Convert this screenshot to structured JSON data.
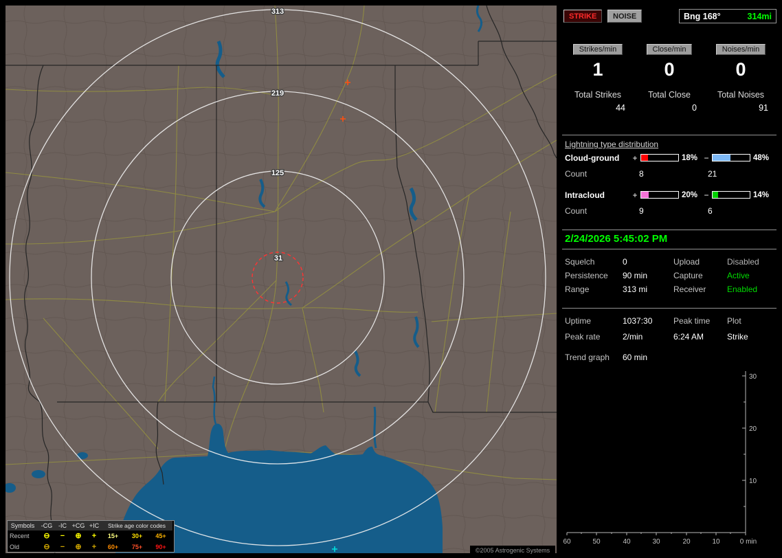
{
  "map": {
    "ring_labels": [
      "313",
      "219",
      "125",
      "31"
    ],
    "legend": {
      "header_symbols": "Symbols",
      "columns": [
        "-CG",
        "-IC",
        "+CG",
        "+IC"
      ],
      "age_title": "Strike age color codes",
      "symbols": [
        "⊖",
        "−",
        "⊕",
        "+"
      ],
      "rows": [
        {
          "label": "Recent",
          "symbol_color": "#ffff00",
          "ages": [
            {
              "text": "15+",
              "color": "#ffff80"
            },
            {
              "text": "30+",
              "color": "#ffe000"
            },
            {
              "text": "45+",
              "color": "#ffb400"
            }
          ]
        },
        {
          "label": "Old",
          "symbol_color": "#d2a800",
          "ages": [
            {
              "text": "60+",
              "color": "#ff8c00"
            },
            {
              "text": "75+",
              "color": "#ff5028"
            },
            {
              "text": "90+",
              "color": "#ff1414"
            }
          ]
        }
      ]
    },
    "copyright": "©2005 Astrogenic Systems"
  },
  "panel": {
    "strike_button": "STRIKE",
    "noise_button": "NOISE",
    "bearing": {
      "label": "Bng 168°",
      "distance": "314mi",
      "distance_color": "#00ff00"
    },
    "columns": [
      {
        "header": "Strikes/min",
        "per_min": "1",
        "total_label": "Total Strikes",
        "total": "44"
      },
      {
        "header": "Close/min",
        "per_min": "0",
        "total_label": "Total Close",
        "total": "0"
      },
      {
        "header": "Noises/min",
        "per_min": "0",
        "total_label": "Total Noises",
        "total": "91"
      }
    ],
    "distribution": {
      "title": "Lightning type distribution",
      "count_label": "Count",
      "plus_sign": "+",
      "minus_sign": "−",
      "rows": [
        {
          "label": "Cloud-ground",
          "pos": {
            "pct": 18,
            "pct_text": "18%",
            "count": "8",
            "color": "#ff0000"
          },
          "neg": {
            "pct": 48,
            "pct_text": "48%",
            "count": "21",
            "color": "#7db8f5"
          }
        },
        {
          "label": "Intracloud",
          "pos": {
            "pct": 20,
            "pct_text": "20%",
            "count": "9",
            "color": "#f473d8"
          },
          "neg": {
            "pct": 14,
            "pct_text": "14%",
            "count": "6",
            "color": "#00d200"
          }
        }
      ]
    },
    "datetime": "2/24/2026 5:45:02 PM",
    "datetime_color": "#00ff00",
    "settings_rows": [
      {
        "l1": "Squelch",
        "v1": "0",
        "l2": "Upload",
        "v2": "Disabled",
        "v2_color": "#b4b4b4"
      },
      {
        "l1": "Persistence",
        "v1": "90 min",
        "l2": "Capture",
        "v2": "Active",
        "v2_color": "#00dc00"
      },
      {
        "l1": "Range",
        "v1": "313 mi",
        "l2": "Receiver",
        "v2": "Enabled",
        "v2_color": "#00dc00"
      }
    ],
    "status_rows": [
      {
        "c1": "Uptime",
        "c2": "1037:30",
        "c3": "Peak time",
        "c4": "Plot"
      },
      {
        "c1": "Peak rate",
        "c2": "2/min",
        "c3": "6:24 AM",
        "c4": "Strike"
      }
    ],
    "trend": {
      "label": "Trend graph",
      "value": "60 min",
      "y_ticks": [
        "30",
        "20",
        "10"
      ],
      "x_ticks": [
        "60",
        "50",
        "40",
        "30",
        "20",
        "10"
      ],
      "origin_label": "0 min"
    }
  },
  "chart_data": {
    "type": "line",
    "title": "Trend graph",
    "xlabel": "min",
    "x_ticks": [
      60,
      50,
      40,
      30,
      20,
      10,
      0
    ],
    "y_ticks": [
      0,
      10,
      20,
      30
    ],
    "ylim": [
      0,
      30
    ],
    "grid": false,
    "legend_position": "none",
    "series": [
      {
        "name": "Strike",
        "values": []
      }
    ]
  }
}
